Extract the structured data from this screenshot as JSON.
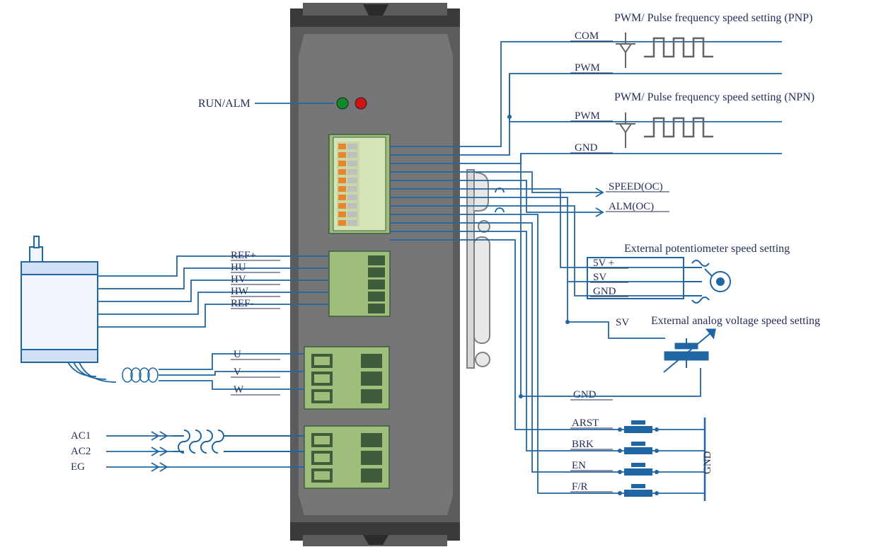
{
  "leds": {
    "run_alm": "RUN/ALM"
  },
  "hall": {
    "refp": "REF+",
    "hu": "HU",
    "hv": "HV",
    "hw": "HW",
    "refn": "REF-"
  },
  "power_phase": {
    "u": "U",
    "v": "V",
    "w": "W"
  },
  "supply": {
    "ac1": "AC1",
    "ac2": "AC2",
    "eg": "EG"
  },
  "pnp": {
    "title": "PWM/ Pulse frequency speed setting (PNP)",
    "com": "COM",
    "pwm": "PWM"
  },
  "npn": {
    "title": "PWM/ Pulse frequency speed setting (NPN)",
    "pwm": "PWM",
    "gnd": "GND"
  },
  "oc": {
    "speed": "SPEED(OC)",
    "alm": "ALM(OC)"
  },
  "pot": {
    "title": "External potentiometer speed setting",
    "v5": "5V +",
    "sv": "SV",
    "gnd": "GND"
  },
  "analog": {
    "title": "External analog voltage speed setting",
    "sv": "SV",
    "gnd": "GND"
  },
  "ctrl": {
    "arst": "ARST",
    "brk": "BRK",
    "en": "EN",
    "fr": "F/R",
    "gnd": "GND"
  }
}
